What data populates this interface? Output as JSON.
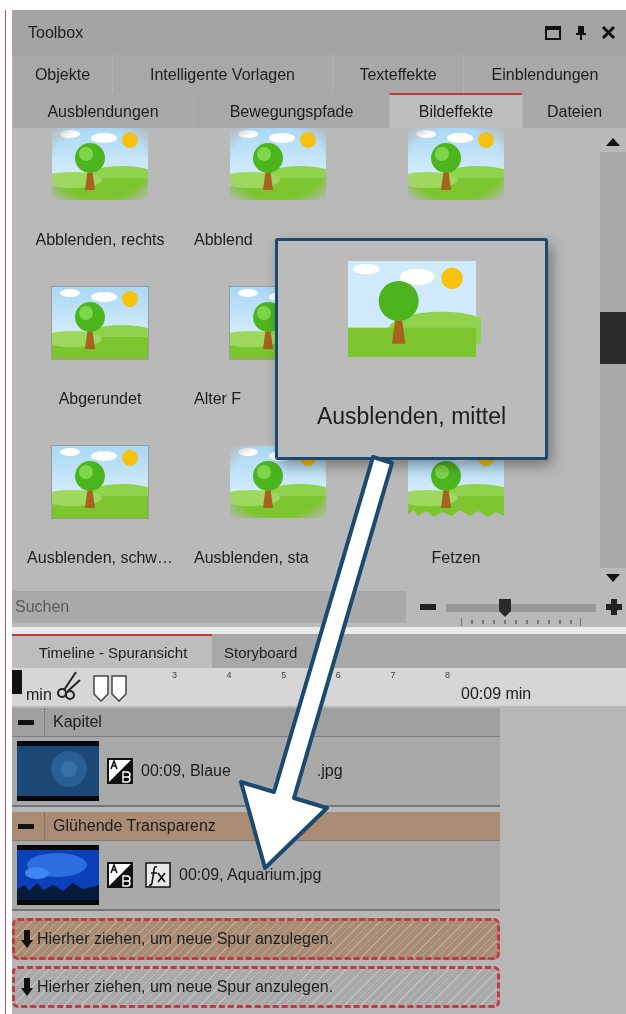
{
  "window": {
    "title": "Toolbox"
  },
  "tab_rows": [
    [
      {
        "label": "Objekte",
        "selected": false
      },
      {
        "label": "Intelligente Vorlagen",
        "selected": false
      },
      {
        "label": "Texteffekte",
        "selected": false
      },
      {
        "label": "Einblendungen",
        "selected": false
      }
    ],
    [
      {
        "label": "Ausblendungen",
        "selected": false
      },
      {
        "label": "Bewegungspfade",
        "selected": false
      },
      {
        "label": "Bildeffekte",
        "selected": true
      },
      {
        "label": "Dateien",
        "selected": false
      }
    ]
  ],
  "effects": [
    {
      "label": "Abblenden, rechts",
      "kind": "fade"
    },
    {
      "label": "Abblend",
      "kind": "fade"
    },
    {
      "kind": "fade"
    },
    {
      "label": "Abgerundet",
      "kind": "plain"
    },
    {
      "label": "Alter F",
      "kind": "plain"
    },
    {
      "kind": "empty"
    },
    {
      "label": "Ausblenden, schw…",
      "kind": "plain"
    },
    {
      "label": "Ausblenden, sta",
      "kind": "fade"
    },
    {
      "label": "Fetzen",
      "kind": "torn"
    }
  ],
  "search": {
    "placeholder": "Suchen"
  },
  "zoom_slider": {
    "level": 0.39
  },
  "popup": {
    "label": "Ausblenden, mittel"
  },
  "timeline_tabs": [
    {
      "label": "Timeline - Spuransicht",
      "selected": true
    },
    {
      "label": "Storyboard",
      "selected": false
    }
  ],
  "ruler": {
    "start": "min",
    "ticks": [
      "3",
      "4",
      "5",
      "6",
      "7",
      "8"
    ],
    "end": "00:09 min"
  },
  "tracks": [
    {
      "kind": "header",
      "label": "Kapitel",
      "color": "#a0a0a0"
    },
    {
      "kind": "clip",
      "transition": true,
      "effect": false,
      "text": "00:09, Blaue",
      "tail": ".jpg"
    },
    {
      "kind": "header",
      "label": "Glühende Transparenz",
      "color": "#a98c73"
    },
    {
      "kind": "clip",
      "transition": true,
      "effect": true,
      "text": "00:09, Aquarium.jpg"
    },
    {
      "kind": "dropzone",
      "label": "Hierher ziehen, um neue Spur anzulegen.",
      "color": "#a88c74"
    },
    {
      "kind": "dropzone",
      "label": "Hierher ziehen, um neue Spur anzulegen.",
      "color": "#a9a9a9"
    }
  ]
}
